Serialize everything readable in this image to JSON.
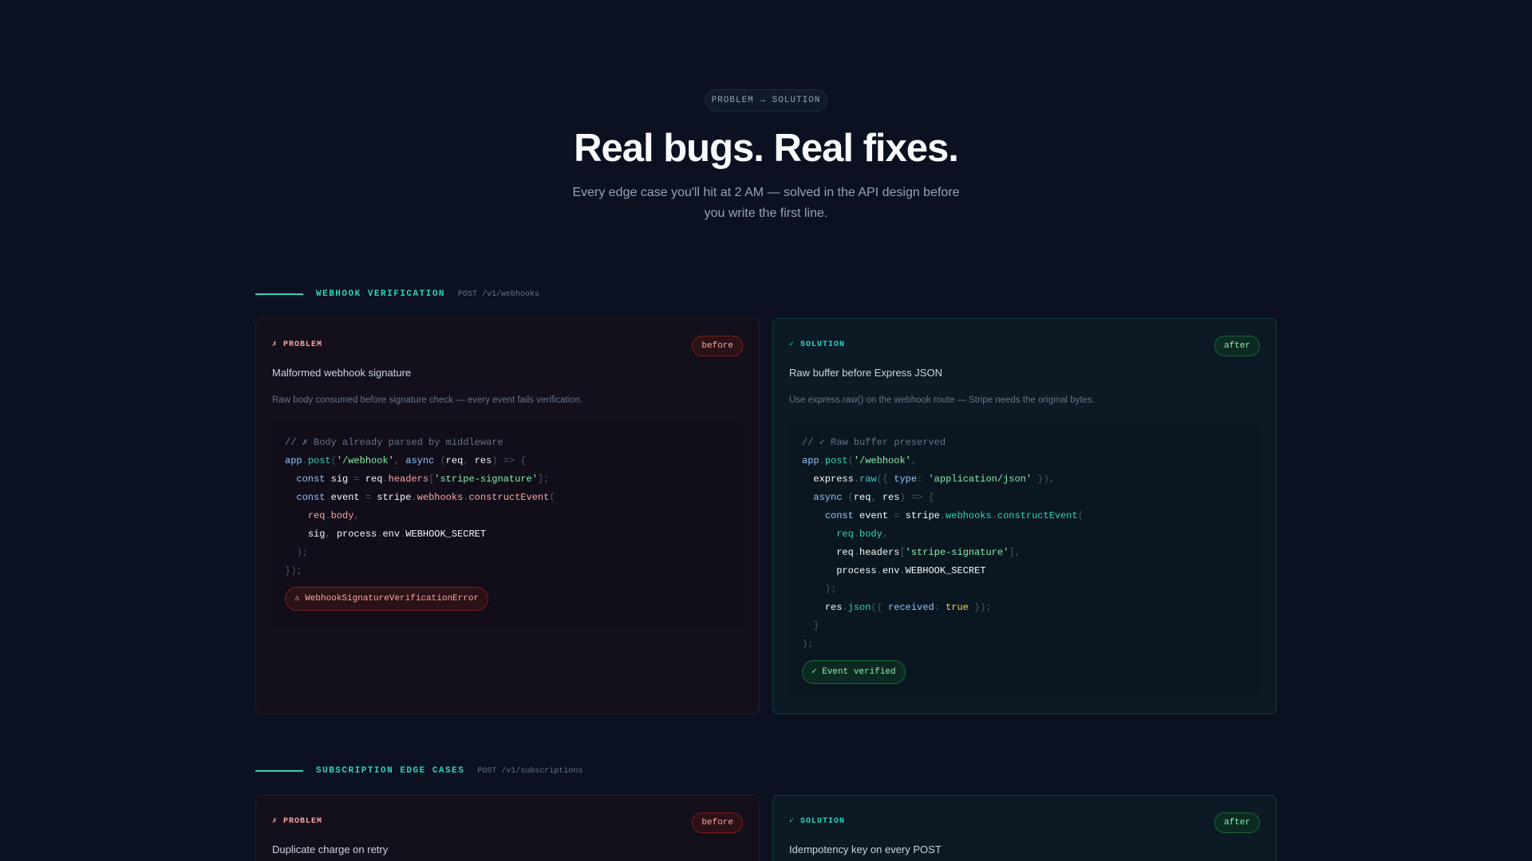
{
  "hero": {
    "eyebrow": "PROBLEM → SOLUTION",
    "title": "Real bugs. Real fixes.",
    "subtitle": "Every edge case you'll hit at 2 AM — solved in the API design before you write the first line."
  },
  "sections": [
    {
      "title": "WEBHOOK VERIFICATION",
      "route": "POST /v1/webhooks",
      "problem": {
        "label": "✗ PROBLEM",
        "pill": "before",
        "title": "Malformed webhook signature",
        "description": "Raw body consumed before signature check — every event fails verification.",
        "code": [
          "// ✗ Body already parsed by middleware",
          "app.post('/webhook', async (req, res) => {",
          "  const sig = req.headers['stripe-signature'];",
          "  const event = stripe.webhooks.constructEvent(",
          "    req.body,",
          "    sig, process.env.WEBHOOK_SECRET",
          "  );",
          "});"
        ],
        "result": "⚠ WebhookSignatureVerificationError"
      },
      "solution": {
        "label": "✓ SOLUTION",
        "pill": "after",
        "title": "Raw buffer before Express JSON",
        "description": "Use express.raw() on the webhook route — Stripe needs the original bytes.",
        "code": [
          "// ✓ Raw buffer preserved",
          "app.post('/webhook',",
          "  express.raw({ type: 'application/json' }),",
          "  async (req, res) => {",
          "    const event = stripe.webhooks.constructEvent(",
          "      req.body,",
          "      req.headers['stripe-signature'],",
          "      process.env.WEBHOOK_SECRET",
          "    );",
          "    res.json({ received: true });",
          "  }",
          ");"
        ],
        "result": "✓ Event verified"
      }
    },
    {
      "title": "SUBSCRIPTION EDGE CASES",
      "route": "POST /v1/subscriptions",
      "problem": {
        "label": "✗ PROBLEM",
        "pill": "before",
        "title": "Duplicate charge on retry"
      },
      "solution": {
        "label": "✓ SOLUTION",
        "pill": "after",
        "title": "Idempotency key on every POST"
      }
    }
  ]
}
